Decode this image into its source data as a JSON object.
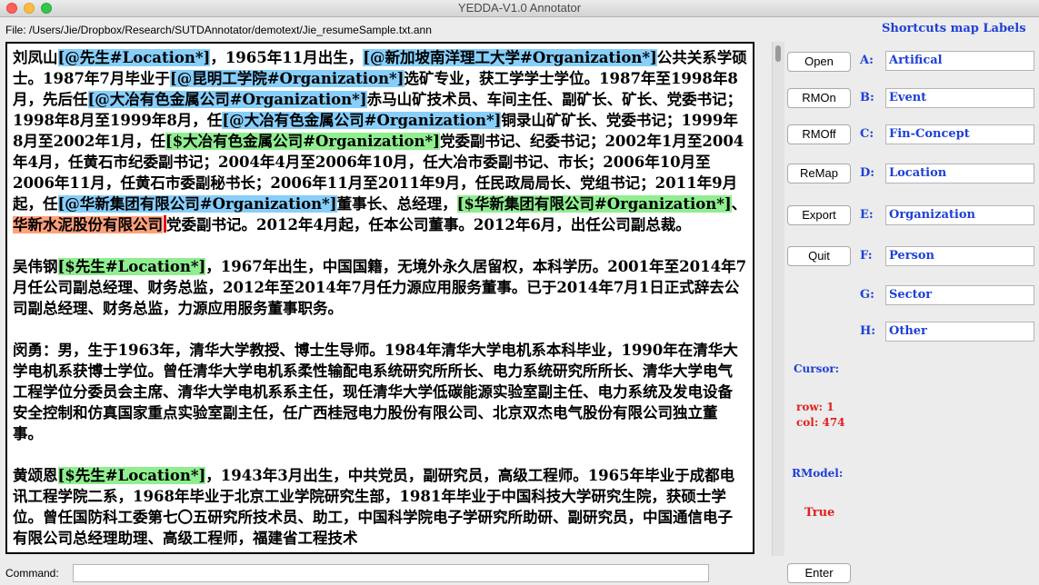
{
  "window": {
    "title": "YEDDA-V1.0 Annotator"
  },
  "file": {
    "path": "File: /Users/Jie/Dropbox/Research/SUTDAnnotator/demotext/Jie_resumeSample.txt.ann"
  },
  "editor": {
    "paragraphs": [
      [
        {
          "t": "刘凤山"
        },
        {
          "t": "[@先生#Location*]",
          "c": "blue"
        },
        {
          "t": "，1965年11月出生，"
        },
        {
          "t": "[@新加坡南洋理工大学#Organization*]",
          "c": "blue"
        },
        {
          "t": "公共关系学硕士。1987年7月毕业于"
        },
        {
          "t": "[@昆明工学院#Organization*]",
          "c": "blue"
        },
        {
          "t": "选矿专业，获工学学士学位。1987年至1998年8月，先后任"
        },
        {
          "t": "[@大冶有色金属公司#Organization*]",
          "c": "blue"
        },
        {
          "t": "赤马山矿技术员、车间主任、副矿长、矿长、党委书记；1998年8月至1999年8月，任"
        },
        {
          "t": "[@大冶有色金属公司#Organization*]",
          "c": "blue"
        },
        {
          "t": "铜录山矿矿长、党委书记；1999年8月至2002年1月，任"
        },
        {
          "t": "[$大冶有色金属公司#Organization*]",
          "c": "green"
        },
        {
          "t": "党委副书记、纪委书记；2002年1月至2004年4月，任黄石市纪委副书记；2004年4月至2006年10月，任大冶市委副书记、市长；2006年10月至2006年11月，任黄石市委副秘书长；2006年11月至2011年9月，任民政局局长、党组书记；2011年9月起，任"
        },
        {
          "t": "[@华新集团有限公司#Organization*]",
          "c": "blue"
        },
        {
          "t": "董事长、总经理，"
        },
        {
          "t": "[$华新集团有限公司#Organization*]",
          "c": "green"
        },
        {
          "t": "、"
        },
        {
          "t": "华新水泥股份有限公司",
          "c": "salmon",
          "cursor": true
        },
        {
          "t": "党委副书记。2012年4月起，任本公司董事。2012年6月，出任公司副总裁。"
        }
      ],
      [
        {
          "t": "吴伟钢"
        },
        {
          "t": "[$先生#Location*]",
          "c": "green"
        },
        {
          "t": "，1967年出生，中国国籍，无境外永久居留权，本科学历。2001年至2014年7月任公司副总经理、财务总监，2012年至2014年7月任力源应用服务董事。已于2014年7月1日正式辞去公司副总经理、财务总监，力源应用服务董事职务。"
        }
      ],
      [
        {
          "t": "闵勇：男，生于1963年，清华大学教授、博士生导师。1984年清华大学电机系本科毕业，1990年在清华大学电机系获博士学位。曾任清华大学电机系柔性输配电系统研究所所长、电力系统研究所所长、清华大学电气工程学位分委员会主席、清华大学电机系系主任，现任清华大学低碳能源实验室副主任、电力系统及发电设备安全控制和仿真国家重点实验室副主任，任广西桂冠电力股份有限公司、北京双杰电气股份有限公司独立董事。"
        }
      ],
      [
        {
          "t": "黄颂恩"
        },
        {
          "t": "[$先生#Location*]",
          "c": "green"
        },
        {
          "t": "，1943年3月出生，中共党员，副研究员，高级工程师。1965年毕业于成都电讯工程学院二系，1968年毕业于北京工业学院研究生部，1981年毕业于中国科技大学研究生院，获硕士学位。曾任国防科工委第七〇五研究所技术员、助工，中国科学院电子学研究所助研、副研究员，中国通信电子有限公司总经理助理、高级工程师，福建省工程技术"
        }
      ]
    ]
  },
  "buttons": {
    "open": "Open",
    "rmon": "RMOn",
    "rmoff": "RMOff",
    "remap": "ReMap",
    "export": "Export",
    "quit": "Quit",
    "enter": "Enter"
  },
  "shortcuts": {
    "title": "Shortcuts map Labels",
    "items": [
      {
        "key": "A:",
        "label": "Artifical"
      },
      {
        "key": "B:",
        "label": "Event"
      },
      {
        "key": "C:",
        "label": "Fin-Concept"
      },
      {
        "key": "D:",
        "label": "Location"
      },
      {
        "key": "E:",
        "label": "Organization"
      },
      {
        "key": "F:",
        "label": "Person"
      },
      {
        "key": "G:",
        "label": "Sector"
      },
      {
        "key": "H:",
        "label": "Other"
      }
    ]
  },
  "status": {
    "cursor_label": "Cursor:",
    "row": "row: 1",
    "col": "col: 474",
    "rmodel_label": "RModel:",
    "rmodel_value": "True"
  },
  "command": {
    "label": "Command:",
    "value": "",
    "placeholder": ""
  },
  "colors": {
    "tag_blue": "#87cefa",
    "tag_green": "#90ee90",
    "tag_salmon": "#ffa07a",
    "label_text": "#1e40d6",
    "status_red": "#e02020"
  }
}
